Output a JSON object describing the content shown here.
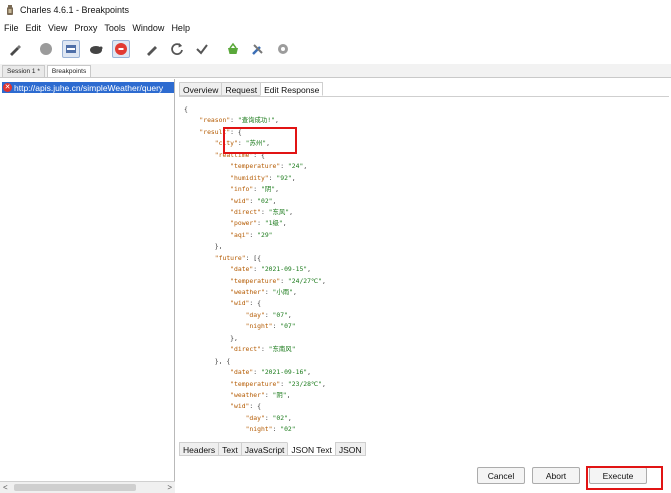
{
  "window": {
    "title": "Charles 4.6.1 - Breakpoints",
    "app_icon": "charles-jug-icon"
  },
  "menu": [
    {
      "label": "File"
    },
    {
      "label": "Edit"
    },
    {
      "label": "View"
    },
    {
      "label": "Proxy"
    },
    {
      "label": "Tools"
    },
    {
      "label": "Window"
    },
    {
      "label": "Help"
    }
  ],
  "toolbar": {
    "buttons": [
      "pen-icon",
      "record-icon",
      "throttle-icon",
      "turtle-icon",
      "breakpoint-icon",
      "compose-icon",
      "repeat-icon",
      "validate-icon",
      "basket-icon",
      "tools-icon",
      "settings-icon"
    ]
  },
  "session_tabs": [
    {
      "label": "Session 1 *"
    },
    {
      "label": "Breakpoints"
    }
  ],
  "breakpoints": {
    "items": [
      {
        "url": "http://apis.juhe.cn/simpleWeather/query",
        "status_icon": "breakpoint-error-icon"
      }
    ]
  },
  "request_tabs": [
    {
      "label": "Overview"
    },
    {
      "label": "Request"
    },
    {
      "label": "Edit Response"
    }
  ],
  "editor_tabs": [
    {
      "label": "Headers"
    },
    {
      "label": "Text"
    },
    {
      "label": "JavaScript"
    },
    {
      "label": "JSON Text"
    },
    {
      "label": "JSON"
    }
  ],
  "actions": {
    "cancel": "Cancel",
    "abort": "Abort",
    "execute": "Execute"
  },
  "json_text": [
    "{",
    "    \"reason\": \"查询成功!\",",
    "    \"result\": {",
    "        \"city\": \"苏州\",",
    "        \"realtime\": {",
    "            \"temperature\": \"24\",",
    "            \"humidity\": \"92\",",
    "            \"info\": \"阴\",",
    "            \"wid\": \"02\",",
    "            \"direct\": \"东风\",",
    "            \"power\": \"1级\",",
    "            \"aqi\": \"29\"",
    "        },",
    "        \"future\": [{",
    "            \"date\": \"2021-09-15\",",
    "            \"temperature\": \"24/27℃\",",
    "            \"weather\": \"小雨\",",
    "            \"wid\": {",
    "                \"day\": \"07\",",
    "                \"night\": \"07\"",
    "            },",
    "            \"direct\": \"东南风\"",
    "        }, {",
    "            \"date\": \"2021-09-16\",",
    "            \"temperature\": \"23/28℃\",",
    "            \"weather\": \"阴\",",
    "            \"wid\": {",
    "                \"day\": \"02\",",
    "                \"night\": \"02\""
  ]
}
